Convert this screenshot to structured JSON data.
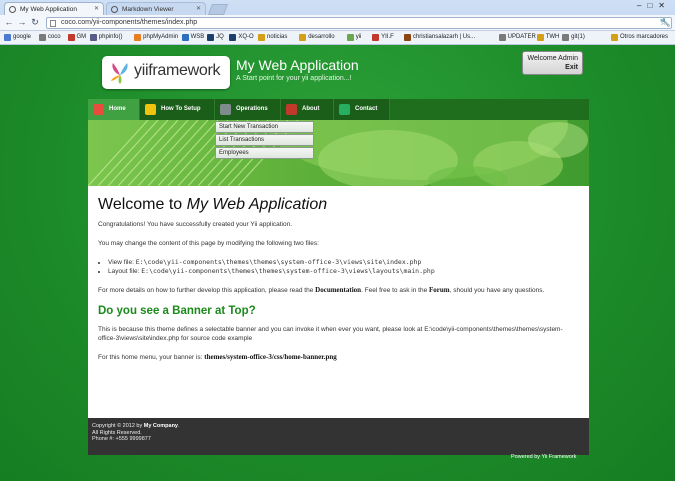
{
  "browser": {
    "tabs": [
      {
        "title": "My Web Application",
        "active": true
      },
      {
        "title": "Markdown Viewer",
        "active": false
      }
    ],
    "address": "coco.com/yii-components/themes/index.php",
    "bookmarks": [
      {
        "label": "google",
        "color": "#4a7bd0"
      },
      {
        "label": "coco",
        "color": "#7a7a7a"
      },
      {
        "label": "GM",
        "color": "#c0392b"
      },
      {
        "label": "phpinfo()",
        "color": "#5a5a8a"
      },
      {
        "label": "phpMyAdmin",
        "color": "#e67e22"
      },
      {
        "label": "WSB",
        "color": "#2c6ebf"
      },
      {
        "label": "JQ",
        "color": "#1c3f6e"
      },
      {
        "label": "XQ-O",
        "color": "#1c3f6e"
      },
      {
        "label": "noticias",
        "color": "#d4a017"
      },
      {
        "label": "desarrollo",
        "color": "#d4a017"
      },
      {
        "label": "yii",
        "color": "#6aa84f"
      },
      {
        "label": "YII.F",
        "color": "#c0392b"
      },
      {
        "label": "christiansalazarh | Us...",
        "color": "#8b4513"
      },
      {
        "label": "UPDATER",
        "color": "#7a7a7a"
      },
      {
        "label": "TWH",
        "color": "#d4a017"
      },
      {
        "label": "git(1)",
        "color": "#7a7a7a"
      },
      {
        "label": "Otros marcadores",
        "color": "#d4a017"
      }
    ]
  },
  "header": {
    "logo_text": "yiiframework",
    "title": "My Web Application",
    "tagline": "A Start point for your yii application...!",
    "welcome": "Welcome Admin",
    "exit": "Exit"
  },
  "menu": {
    "items": [
      {
        "label": "Home",
        "active": true,
        "icon_color": "#e74c3c"
      },
      {
        "label": "How To Setup",
        "active": false,
        "icon_color": "#f1c40f"
      },
      {
        "label": "Operations",
        "active": false,
        "icon_color": "#7f8c8d"
      },
      {
        "label": "About",
        "active": false,
        "icon_color": "#c0392b"
      },
      {
        "label": "Contact",
        "active": false,
        "icon_color": "#27ae60"
      }
    ],
    "dropdown": [
      "Start New Transaction",
      "List Transactions",
      "Employees"
    ]
  },
  "content": {
    "heading_prefix": "Welcome to",
    "heading_app": "My Web Application",
    "congrats": "Congratulations! You have successfully created your Yii application.",
    "modify_intro": "You may change the content of this page by modifying the following two files:",
    "view_label": "View file:",
    "view_path": "E:\\code\\yii-components\\themes\\themes\\system-office-3\\views\\site\\index.php",
    "layout_label": "Layout file:",
    "layout_path": "E:\\code\\yii-components\\themes\\themes\\system-office-3\\views\\layouts\\main.php",
    "details_1": "For more details on how to further develop this application, please read the",
    "details_doc": "Documentation",
    "details_2": ". Feel free to ask in the",
    "details_forum": "Forum",
    "details_3": ", should you have any questions.",
    "banner_heading": "Do you see a Banner at Top?",
    "banner_text": "This is because this theme defines a selectable banner and you can invoke it when ever you want, please look at E:\\code\\yii-components\\themes\\themes\\system-office-3\\views\\site\\index.php for source code example",
    "home_banner_label": "For this home menu, your banner is:",
    "home_banner_path": "themes/system-office-3/css/home-banner.png"
  },
  "footer": {
    "copyright_prefix": "Copyright © 2012 by",
    "company": "My Company",
    "rights": "All Rights Reserved.",
    "phone": "Phone #: +555 9999877",
    "powered": "Powered by Yii Framework"
  },
  "colors": {
    "page_green": "#1f8f2c",
    "menu_dark": "#1a5e1a",
    "menu_active": "#3fa142",
    "heading_green": "#1a8a1a",
    "footer_dark": "#333333"
  }
}
